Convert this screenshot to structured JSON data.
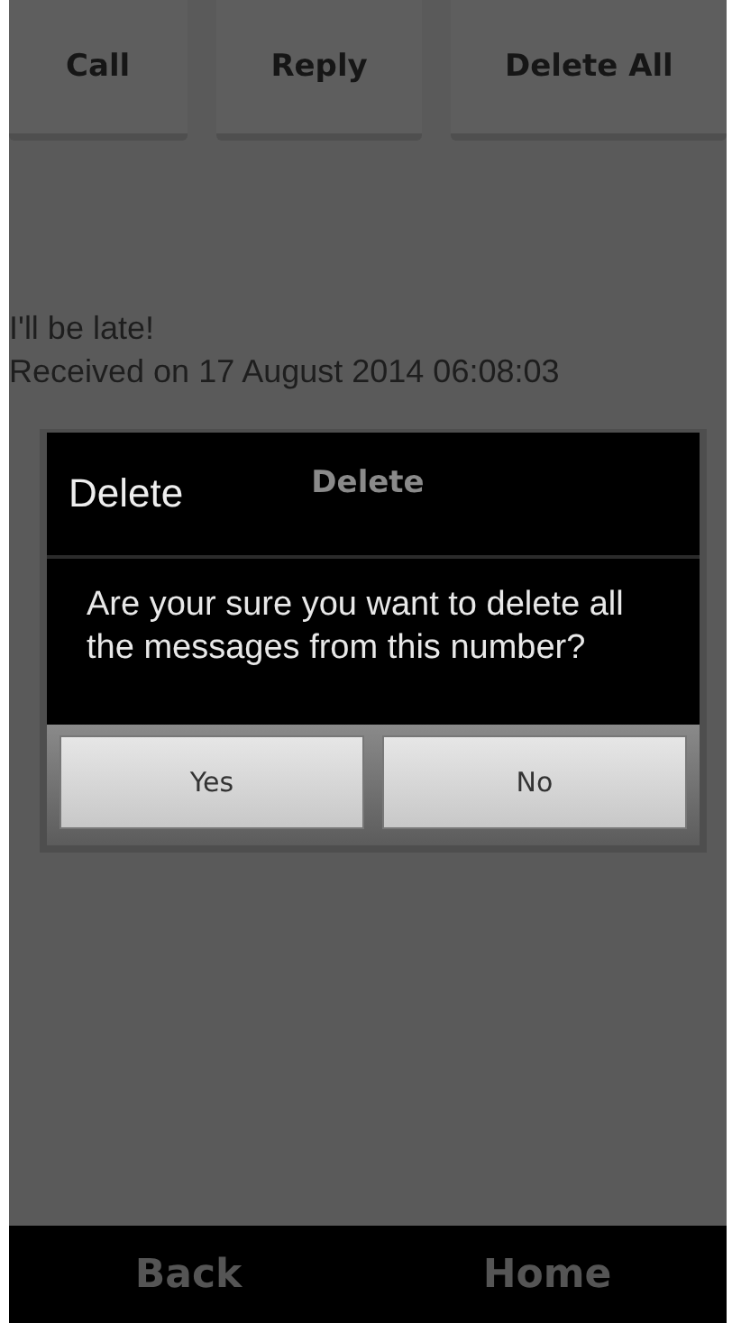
{
  "toolbar": {
    "buttons": [
      "Call",
      "Reply",
      "Delete All"
    ]
  },
  "message": {
    "text": "I'll be late!",
    "received": "Received on 17 August 2014 06:08:03"
  },
  "delete_button": {
    "label": "Delete"
  },
  "dialog": {
    "title": "Delete",
    "message": "Are your sure you want to delete all the messages from this number?",
    "buttons": [
      "Yes",
      "No"
    ]
  },
  "nav_bar": {
    "buttons": [
      "Back",
      "Home"
    ]
  }
}
